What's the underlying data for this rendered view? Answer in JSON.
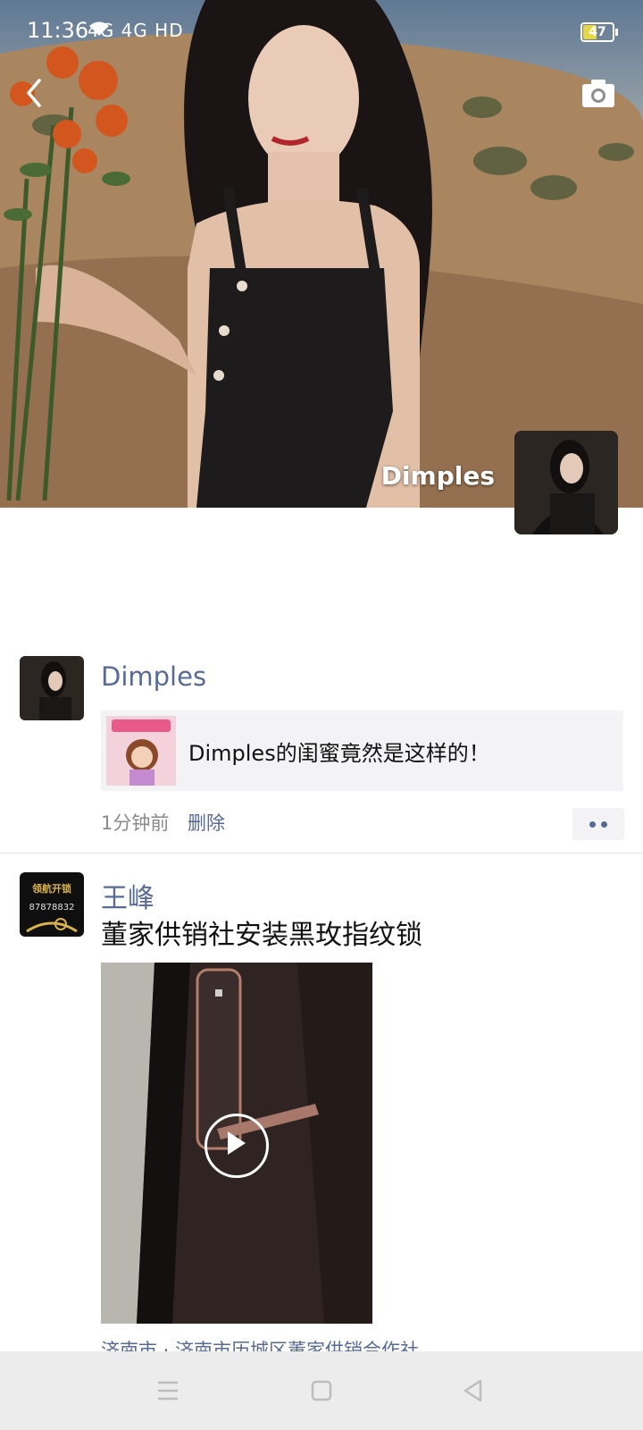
{
  "status_bar": {
    "time": "11:36",
    "network": "4G 4G",
    "hd": "HD",
    "battery": "47",
    "battery_level": 0.47
  },
  "header": {
    "back_icon": "chevron-left-icon",
    "camera_icon": "camera-icon"
  },
  "profile": {
    "name": "Dimples"
  },
  "feed": [
    {
      "author": "Dimples",
      "link_title": "Dimples的闺蜜竟然是这样的！",
      "time": "1分钟前",
      "delete_label": "删除"
    },
    {
      "author": "王峰",
      "text": "董家供销社安装黑玫指纹锁",
      "location": "济南市 · 济南市历城区董家供销合作社",
      "avatar_phone": "87878832",
      "avatar_brand": "领航开锁"
    }
  ],
  "nav": {
    "menu_icon": "menu-icon",
    "home_icon": "square-icon",
    "back_icon": "triangle-back-icon"
  },
  "colors": {
    "author": "#576b95",
    "nav_bg": "#ececec"
  }
}
